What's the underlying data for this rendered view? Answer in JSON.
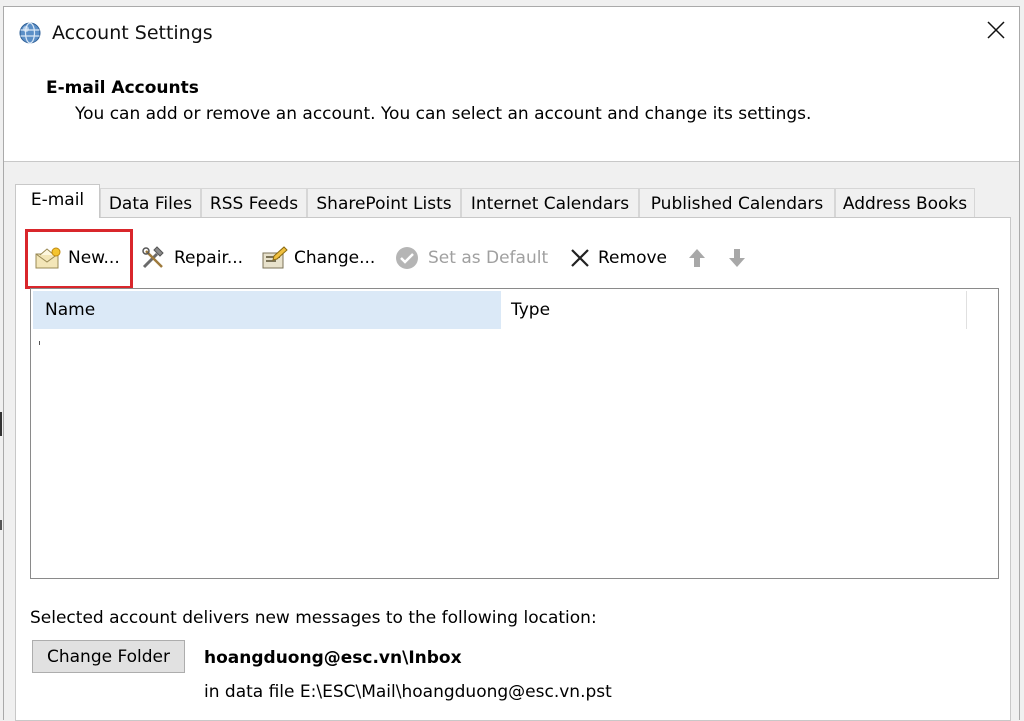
{
  "window": {
    "title": "Account Settings",
    "icon": "outlook-globe-icon",
    "close_icon": "close-icon"
  },
  "header": {
    "title": "E-mail Accounts",
    "description": "You can add or remove an account. You can select an account and change its settings."
  },
  "tabs": [
    {
      "label": "E-mail",
      "active": true
    },
    {
      "label": "Data Files",
      "active": false
    },
    {
      "label": "RSS Feeds",
      "active": false
    },
    {
      "label": "SharePoint Lists",
      "active": false
    },
    {
      "label": "Internet Calendars",
      "active": false
    },
    {
      "label": "Published Calendars",
      "active": false
    },
    {
      "label": "Address Books",
      "active": false
    }
  ],
  "toolbar": {
    "new_label": "New...",
    "repair_label": "Repair...",
    "change_label": "Change...",
    "set_default_label": "Set as Default",
    "remove_label": "Remove",
    "set_default_enabled": false,
    "highlight_color": "#d9262b"
  },
  "account_list": {
    "columns": [
      "Name",
      "Type"
    ],
    "rows": []
  },
  "delivery": {
    "label": "Selected account delivers new messages to the following location:",
    "change_folder_label": "Change Folder",
    "folder_path": "hoangduong@esc.vn\\Inbox",
    "data_file": "in data file E:\\ESC\\Mail\\hoangduong@esc.vn.pst"
  }
}
